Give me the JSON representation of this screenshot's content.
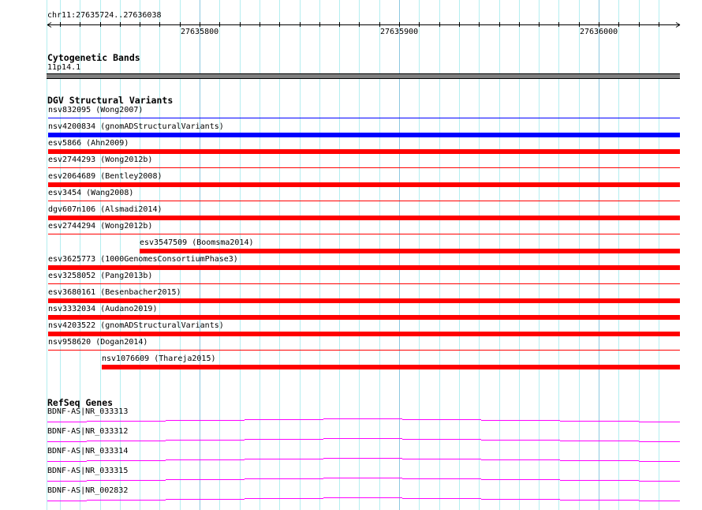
{
  "ruler": {
    "region_label": "chr11:27635724..27636038",
    "start": 27635724,
    "end": 27636038,
    "tick_labels": [
      "27635800",
      "27635900",
      "27636000"
    ]
  },
  "colors": {
    "grid_minor": "#b4eef0",
    "grid_major": "#8cc8e0",
    "variant_loss": "#ff0000",
    "variant_gain": "#0000ff",
    "gene": "#ff00ff",
    "cyto_band": "#808080"
  },
  "tracks": {
    "cytogenetic": {
      "title": "Cytogenetic Bands",
      "band": "11p14.1"
    },
    "dgv": {
      "title": "DGV Structural Variants",
      "variants": [
        {
          "label": "nsv832095 (Wong2007)",
          "color": "#0000ff",
          "style": "thin",
          "start": 27635724
        },
        {
          "label": "nsv4200834 (gnomADStructuralVariants)",
          "color": "#0000ff",
          "style": "thick",
          "start": 27635724
        },
        {
          "label": "esv5866 (Ahn2009)",
          "color": "#ff0000",
          "style": "thick",
          "start": 27635724
        },
        {
          "label": "esv2744293 (Wong2012b)",
          "color": "#ff0000",
          "style": "thin",
          "start": 27635724
        },
        {
          "label": "esv2064689 (Bentley2008)",
          "color": "#ff0000",
          "style": "thick",
          "start": 27635724
        },
        {
          "label": "esv3454 (Wang2008)",
          "color": "#ff0000",
          "style": "thin",
          "start": 27635724
        },
        {
          "label": "dgv607n106 (Alsmadi2014)",
          "color": "#ff0000",
          "style": "thick",
          "start": 27635724
        },
        {
          "label": "esv2744294 (Wong2012b)",
          "color": "#ff0000",
          "style": "thin",
          "start": 27635724
        },
        {
          "label": "esv3547509 (Boomsma2014)",
          "color": "#ff0000",
          "style": "thick",
          "start": 27635770
        },
        {
          "label": "esv3625773 (1000GenomesConsortiumPhase3)",
          "color": "#ff0000",
          "style": "thick",
          "start": 27635724
        },
        {
          "label": "esv3258052 (Pang2013b)",
          "color": "#ff0000",
          "style": "thin",
          "start": 27635724
        },
        {
          "label": "esv3680161 (Besenbacher2015)",
          "color": "#ff0000",
          "style": "thick",
          "start": 27635724
        },
        {
          "label": "nsv3332034 (Audano2019)",
          "color": "#ff0000",
          "style": "thick",
          "start": 27635724
        },
        {
          "label": "nsv4203522 (gnomADStructuralVariants)",
          "color": "#ff0000",
          "style": "thick",
          "start": 27635724
        },
        {
          "label": "nsv958620 (Dogan2014)",
          "color": "#ff0000",
          "style": "thin",
          "start": 27635724
        },
        {
          "label": "nsv1076609 (Thareja2015)",
          "color": "#ff0000",
          "style": "thick",
          "start": 27635751
        }
      ]
    },
    "refseq": {
      "title": "RefSeq Genes",
      "genes": [
        {
          "label": "BDNF-AS|NR_033313"
        },
        {
          "label": "BDNF-AS|NR_033312"
        },
        {
          "label": "BDNF-AS|NR_033314"
        },
        {
          "label": "BDNF-AS|NR_033315"
        },
        {
          "label": "BDNF-AS|NR_002832"
        }
      ]
    }
  }
}
